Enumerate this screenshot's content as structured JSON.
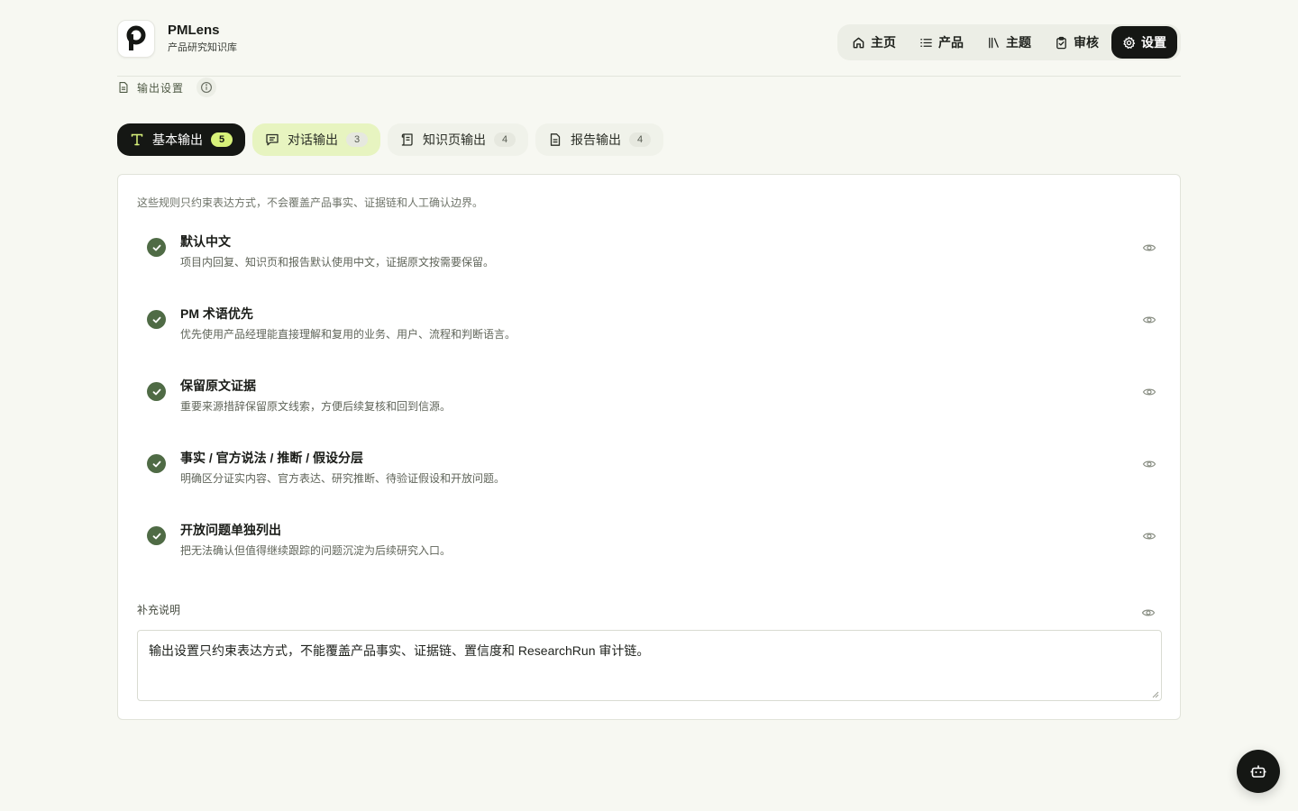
{
  "brand": {
    "name": "PMLens",
    "subtitle": "产品研究知识库"
  },
  "nav": {
    "items": [
      {
        "label": "主页",
        "icon": "home-icon",
        "active": false
      },
      {
        "label": "产品",
        "icon": "list-icon",
        "active": false
      },
      {
        "label": "主题",
        "icon": "library-icon",
        "active": false
      },
      {
        "label": "审核",
        "icon": "clipboard-check-icon",
        "active": false
      },
      {
        "label": "设置",
        "icon": "gear-icon",
        "active": true
      }
    ]
  },
  "breadcrumb": {
    "label": "输出设置",
    "icon": "document-icon",
    "info_icon": "info-icon"
  },
  "tabs": [
    {
      "label": "基本输出",
      "count": "5",
      "icon": "type-icon",
      "state": "active"
    },
    {
      "label": "对话输出",
      "count": "3",
      "icon": "message-icon",
      "state": "hover"
    },
    {
      "label": "知识页输出",
      "count": "4",
      "icon": "scroll-icon",
      "state": "normal"
    },
    {
      "label": "报告输出",
      "count": "4",
      "icon": "document-icon",
      "state": "normal"
    }
  ],
  "card": {
    "intro": "这些规则只约束表达方式，不会覆盖产品事实、证据链和人工确认边界。",
    "rules": [
      {
        "title": "默认中文",
        "desc": "项目内回复、知识页和报告默认使用中文，证据原文按需要保留。"
      },
      {
        "title": "PM 术语优先",
        "desc": "优先使用产品经理能直接理解和复用的业务、用户、流程和判断语言。"
      },
      {
        "title": "保留原文证据",
        "desc": "重要来源措辞保留原文线索，方便后续复核和回到信源。"
      },
      {
        "title": "事实 / 官方说法 / 推断 / 假设分层",
        "desc": "明确区分证实内容、官方表达、研究推断、待验证假设和开放问题。"
      },
      {
        "title": "开放问题单独列出",
        "desc": "把无法确认但值得继续跟踪的问题沉淀为后续研究入口。"
      }
    ],
    "supplement": {
      "label": "补充说明",
      "value": "输出设置只约束表达方式，不能覆盖产品事实、证据链、置信度和 ResearchRun 审计链。"
    }
  },
  "colors": {
    "accent": "#151714",
    "check": "#4f6b45",
    "badge": "#d8f27a",
    "hover_tab": "#e7f4c0"
  }
}
